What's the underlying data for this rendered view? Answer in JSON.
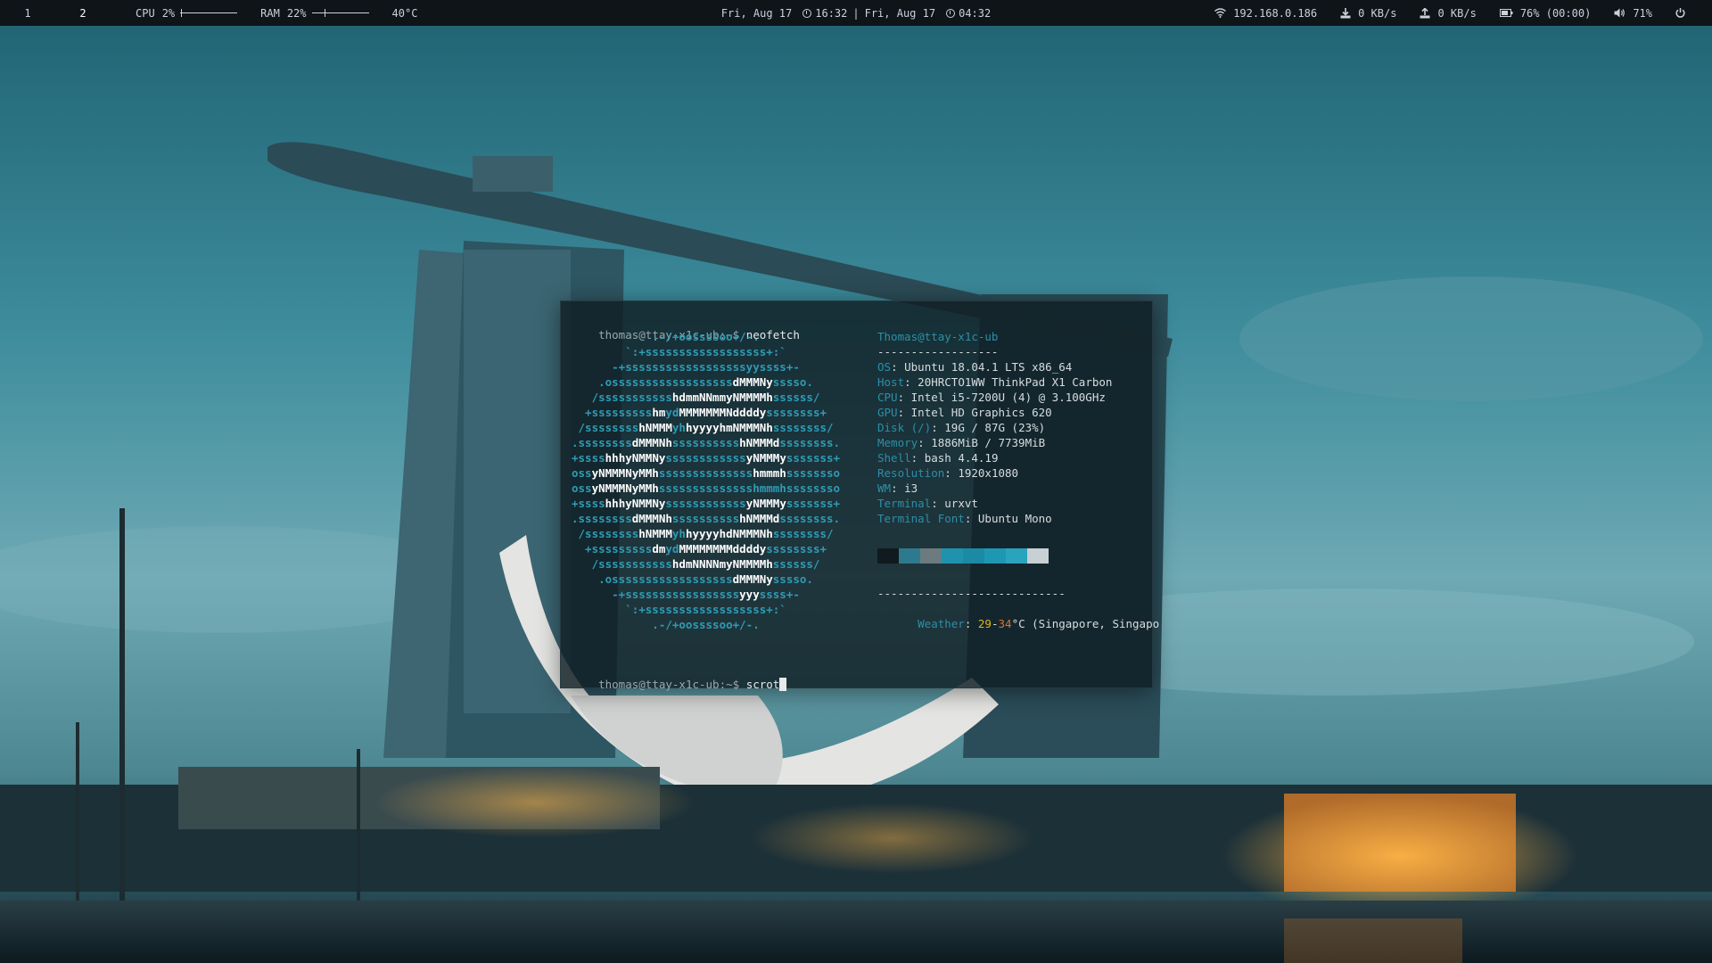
{
  "topbar": {
    "workspaces": [
      "1",
      "2"
    ],
    "active_workspace": "2",
    "cpu": {
      "label": "CPU",
      "value": "2%",
      "level": 0.02
    },
    "ram": {
      "label": "RAM",
      "value": "22%",
      "level": 0.22
    },
    "temperature": "40°C",
    "clock": {
      "local_date": "Fri, Aug 17",
      "local_time": "16:32",
      "separator": "|",
      "remote_date": "Fri, Aug 17",
      "remote_time": "04:32"
    },
    "network": {
      "ip": "192.168.0.186",
      "download": "0 KB/s",
      "upload": "0 KB/s"
    },
    "battery": "76% (00:00)",
    "volume": "71%",
    "icons": [
      "workspace",
      "clock-icon",
      "wifi-icon",
      "download-icon",
      "upload-icon",
      "battery-icon",
      "volume-icon",
      "power-icon"
    ]
  },
  "terminal": {
    "prompt": "thomas@ttay-x1c-ub:~$",
    "command1": "neofetch",
    "command2": "scrot",
    "ascii_art": [
      [
        [
          "            .-/+oossssoo+/-.",
          "c1"
        ]
      ],
      [
        [
          "        `:+ssssssssssssssssss+:`",
          "c1"
        ]
      ],
      [
        [
          "      -+ssssssssssssssssssyyssss+-",
          "c1"
        ]
      ],
      [
        [
          "    .ossssssssssssssssss",
          "c1"
        ],
        [
          "dMMMNy",
          "c2"
        ],
        [
          "sssso.",
          "c1"
        ]
      ],
      [
        [
          "   /sssssssssss",
          "c1"
        ],
        [
          "hdmmNNmmyNMMMMh",
          "c2"
        ],
        [
          "ssssss/",
          "c1"
        ]
      ],
      [
        [
          "  +sssssssss",
          "c1"
        ],
        [
          "hm",
          "c2"
        ],
        [
          "yd",
          "c1"
        ],
        [
          "MMMMMMMNddddy",
          "c2"
        ],
        [
          "ssssssss+",
          "c1"
        ]
      ],
      [
        [
          " /ssssssss",
          "c1"
        ],
        [
          "hNMMM",
          "c2"
        ],
        [
          "yh",
          "c1"
        ],
        [
          "hyyyyhmNMMMNh",
          "c2"
        ],
        [
          "ssssssss/",
          "c1"
        ]
      ],
      [
        [
          ".ssssssss",
          "c1"
        ],
        [
          "dMMMNh",
          "c2"
        ],
        [
          "ssssssssss",
          "c1"
        ],
        [
          "hNMMMd",
          "c2"
        ],
        [
          "ssssssss.",
          "c1"
        ]
      ],
      [
        [
          "+ssss",
          "c1"
        ],
        [
          "hhhyNMMNy",
          "c2"
        ],
        [
          "ssssssssssss",
          "c1"
        ],
        [
          "yNMMMy",
          "c2"
        ],
        [
          "sssssss+",
          "c1"
        ]
      ],
      [
        [
          "oss",
          "c1"
        ],
        [
          "yNMMMNyMMh",
          "c2"
        ],
        [
          "ssssssssssssss",
          "c1"
        ],
        [
          "hmmmh",
          "c2"
        ],
        [
          "ssssssso",
          "c1"
        ]
      ],
      [
        [
          "oss",
          "c1"
        ],
        [
          "yNMMMNyMMh",
          "c2"
        ],
        [
          "sssssssssssssshmmmhssssssso",
          "c1"
        ]
      ],
      [
        [
          "+ssss",
          "c1"
        ],
        [
          "hhhyNMMNy",
          "c2"
        ],
        [
          "ssssssssssss",
          "c1"
        ],
        [
          "yNMMMy",
          "c2"
        ],
        [
          "sssssss+",
          "c1"
        ]
      ],
      [
        [
          ".ssssssss",
          "c1"
        ],
        [
          "dMMMNh",
          "c2"
        ],
        [
          "ssssssssss",
          "c1"
        ],
        [
          "hNMMMd",
          "c2"
        ],
        [
          "ssssssss.",
          "c1"
        ]
      ],
      [
        [
          " /ssssssss",
          "c1"
        ],
        [
          "hNMMM",
          "c2"
        ],
        [
          "yh",
          "c1"
        ],
        [
          "hyyyyhdNMMMNh",
          "c2"
        ],
        [
          "ssssssss/",
          "c1"
        ]
      ],
      [
        [
          "  +sssssssss",
          "c1"
        ],
        [
          "dm",
          "c2"
        ],
        [
          "yd",
          "c1"
        ],
        [
          "MMMMMMMMddddy",
          "c2"
        ],
        [
          "ssssssss+",
          "c1"
        ]
      ],
      [
        [
          "   /sssssssssss",
          "c1"
        ],
        [
          "hdmNNNNmyNMMMMh",
          "c2"
        ],
        [
          "ssssss/",
          "c1"
        ]
      ],
      [
        [
          "    .ossssssssssssssssss",
          "c1"
        ],
        [
          "dMMMNy",
          "c2"
        ],
        [
          "sssso.",
          "c1"
        ]
      ],
      [
        [
          "      -+sssssssssssssssss",
          "c1"
        ],
        [
          "yyy",
          "c2"
        ],
        [
          "ssss+-",
          "c1"
        ]
      ],
      [
        [
          "        `:+ssssssssssssssssss+:`",
          "c1"
        ]
      ],
      [
        [
          "            .-/+oossssoo+/-.",
          "c1"
        ]
      ]
    ],
    "info": {
      "user_host": "Thomas@ttay-x1c-ub",
      "separator": "------------------",
      "rows": [
        {
          "key": "OS",
          "value": "Ubuntu 18.04.1 LTS x86_64"
        },
        {
          "key": "Host",
          "value": "20HRCTO1WW ThinkPad X1 Carbon"
        },
        {
          "key": "CPU",
          "value": "Intel i5-7200U (4) @ 3.100GHz"
        },
        {
          "key": "GPU",
          "value": "Intel HD Graphics 620"
        },
        {
          "key": "Disk (/)",
          "value": "19G / 87G (23%)"
        },
        {
          "key": "Memory",
          "value": "1886MiB / 7739MiB"
        },
        {
          "key": "Shell",
          "value": "bash 4.4.19"
        },
        {
          "key": "Resolution",
          "value": "1920x1080"
        },
        {
          "key": "WM",
          "value": "i3"
        },
        {
          "key": "Terminal",
          "value": "urxvt"
        },
        {
          "key": "Terminal Font",
          "value": "Ubuntu Mono"
        }
      ],
      "palette": [
        "#111a1e",
        "#2d7a8f",
        "#6b7b80",
        "#1f93ad",
        "#1a8aa5",
        "#1e97b2",
        "#2aa3bd",
        "#c8d0d3"
      ],
      "weather_separator": "----------------------------",
      "weather": {
        "key": "Weather",
        "low": "29",
        "dash": "-",
        "high": "34",
        "rest": "°C (Singapore, Singapo"
      }
    }
  }
}
